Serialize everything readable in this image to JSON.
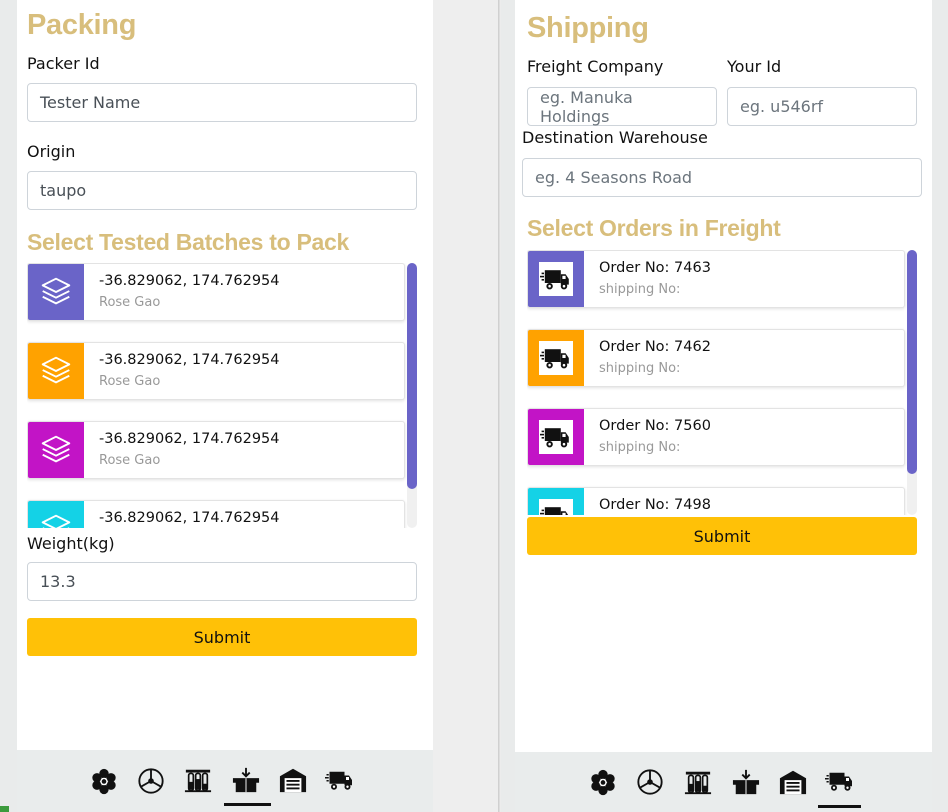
{
  "packing": {
    "title": "Packing",
    "packer_label": "Packer Id",
    "packer_value": "Tester Name",
    "origin_label": "Origin",
    "origin_value": "taupo",
    "batches_title": "Select Tested Batches to Pack",
    "batches": [
      {
        "coords": "-36.829062, 174.762954",
        "name": "Rose Gao",
        "color": "#6a64c8"
      },
      {
        "coords": "-36.829062, 174.762954",
        "name": "Rose Gao",
        "color": "#ffa200"
      },
      {
        "coords": "-36.829062, 174.762954",
        "name": "Rose Gao",
        "color": "#c214c6"
      },
      {
        "coords": "-36.829062, 174.762954",
        "name": "",
        "color": "#14d2e6"
      }
    ],
    "weight_label": "Weight(kg)",
    "weight_value": "13.3",
    "submit_label": "Submit",
    "nav_icons": [
      "flower-icon",
      "steering-wheel-icon",
      "test-tubes-icon",
      "packing-box-icon",
      "warehouse-icon",
      "truck-icon"
    ],
    "active_nav": "packing-box-icon"
  },
  "shipping": {
    "title": "Shipping",
    "freight_label": "Freight Company",
    "freight_placeholder": "eg. Manuka Holdings",
    "your_id_label": "Your Id",
    "your_id_placeholder": "eg. u546rf",
    "destination_label": "Destination Warehouse",
    "destination_placeholder": "eg. 4 Seasons Road",
    "orders_title": "Select Orders in Freight",
    "orders": [
      {
        "order": "Order No: 7463",
        "shipping": "shipping No:",
        "color": "#6a64c8"
      },
      {
        "order": "Order No: 7462",
        "shipping": "shipping No:",
        "color": "#ffa200"
      },
      {
        "order": "Order No: 7560",
        "shipping": "shipping No:",
        "color": "#c214c6"
      },
      {
        "order": "Order No: 7498",
        "shipping": "",
        "color": "#14d2e6"
      }
    ],
    "submit_label": "Submit",
    "nav_icons": [
      "flower-icon",
      "steering-wheel-icon",
      "test-tubes-icon",
      "packing-box-icon",
      "warehouse-icon",
      "truck-icon"
    ],
    "active_nav": "truck-icon"
  },
  "colors": {
    "accent_heading": "#d8be7c",
    "submit": "#ffc107",
    "scroll_thumb": "#6a64c8"
  }
}
